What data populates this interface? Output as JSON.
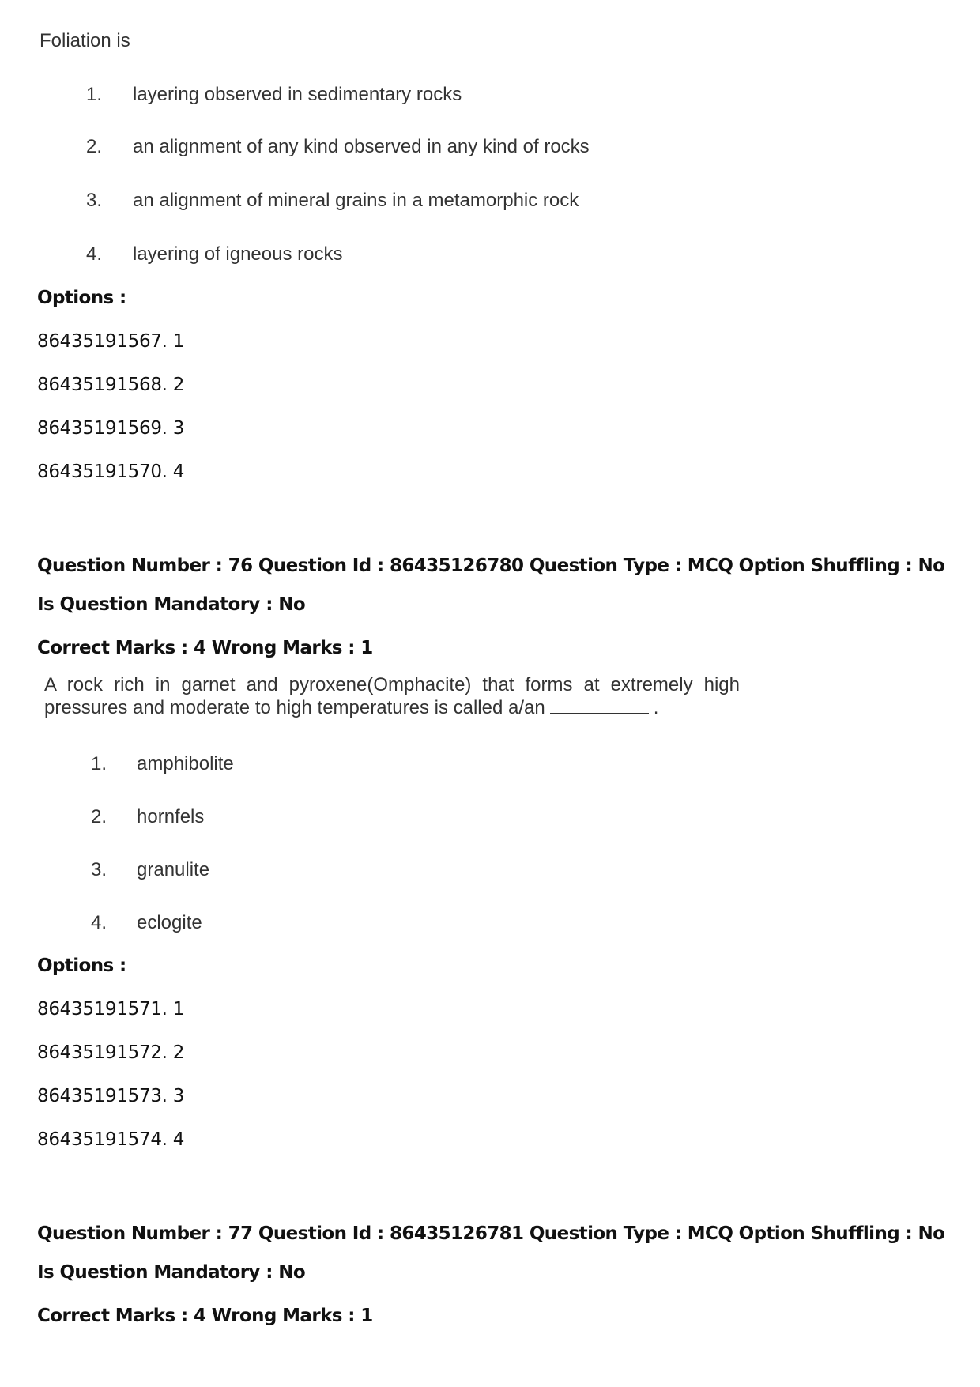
{
  "questions": [
    {
      "stem": "Foliation is",
      "choices": [
        {
          "num": "1.",
          "text": "layering observed in sedimentary rocks"
        },
        {
          "num": "2.",
          "text": "an alignment of any kind observed in any kind of rocks"
        },
        {
          "num": "3.",
          "text": "an alignment of mineral grains in a metamorphic rock"
        },
        {
          "num": "4.",
          "text": "layering of igneous rocks"
        }
      ],
      "options_label": "Options :",
      "options": [
        "86435191567. 1",
        "86435191568. 2",
        "86435191569. 3",
        "86435191570. 4"
      ]
    },
    {
      "header": "Question Number : 76 Question Id : 86435126780 Question Type : MCQ Option Shuffling : No",
      "mandatory": "Is Question Mandatory : No",
      "marks": "Correct Marks : 4 Wrong Marks : 1",
      "stem_line1": "A rock rich in garnet and pyroxene(Omphacite) that forms at extremely high",
      "stem_line2": "pressures and moderate to high temperatures is called a/an",
      "stem_end": ".",
      "choices": [
        {
          "num": "1.",
          "text": "amphibolite"
        },
        {
          "num": "2.",
          "text": "hornfels"
        },
        {
          "num": "3.",
          "text": "granulite"
        },
        {
          "num": "4.",
          "text": "eclogite"
        }
      ],
      "options_label": "Options :",
      "options": [
        "86435191571. 1",
        "86435191572. 2",
        "86435191573. 3",
        "86435191574. 4"
      ]
    },
    {
      "header": "Question Number : 77 Question Id : 86435126781 Question Type : MCQ Option Shuffling : No",
      "mandatory": "Is Question Mandatory : No",
      "marks": "Correct Marks : 4 Wrong Marks : 1"
    }
  ]
}
